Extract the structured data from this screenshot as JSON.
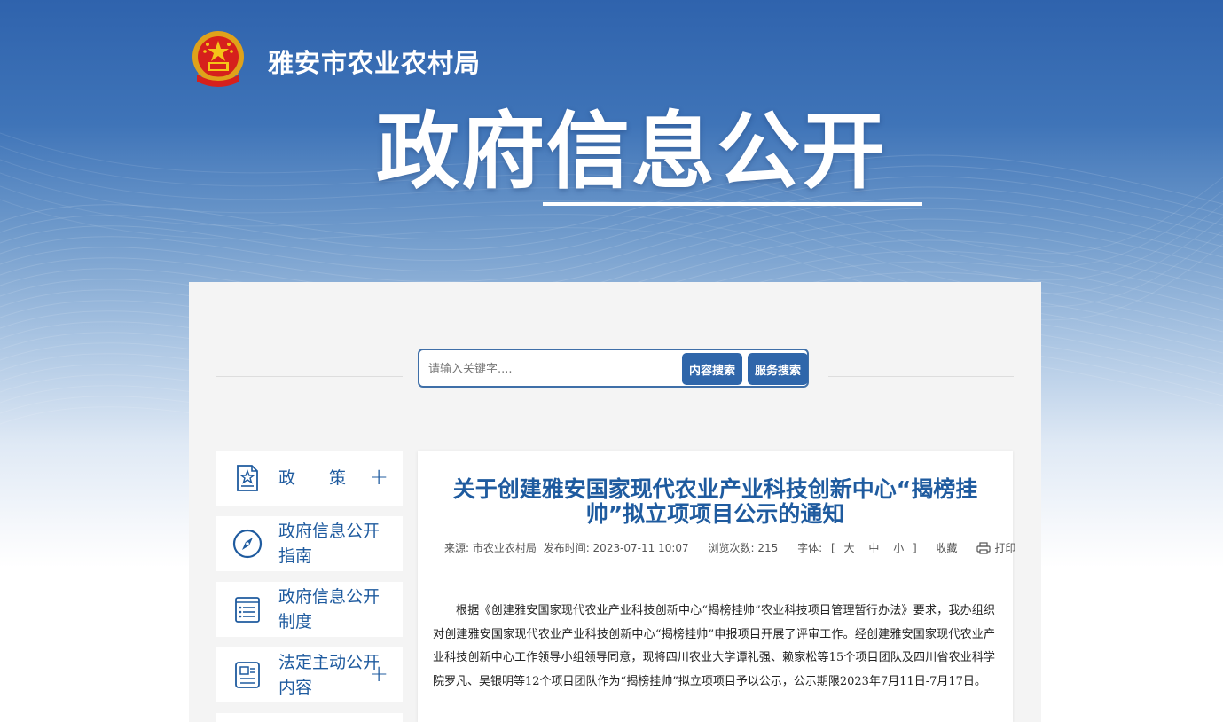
{
  "header": {
    "site_title": "雅安市农业农村局",
    "hero_title": "政府信息公开"
  },
  "search": {
    "placeholder": "请输入关键字....",
    "content_search_label": "内容搜索",
    "service_search_label": "服务搜索"
  },
  "sidebar": {
    "items": [
      {
        "label": "政　　策",
        "icon": "star-document-icon",
        "expandable": true
      },
      {
        "label": "政府信息公开指南",
        "icon": "compass-icon",
        "expandable": false
      },
      {
        "label": "政府信息公开制度",
        "icon": "list-document-icon",
        "expandable": false
      },
      {
        "label": "法定主动公开内容",
        "icon": "id-document-icon",
        "expandable": true
      }
    ],
    "plus_symbol": "+"
  },
  "article": {
    "title": "关于创建雅安国家现代农业产业科技创新中心“揭榜挂帅”拟立项项目公示的通知",
    "meta": {
      "source": "来源: 市农业农村局",
      "publish_time": "发布时间: 2023-07-11 10:07",
      "views": "浏览次数: 215",
      "font_label": "字体:",
      "bracket_open": "[",
      "font_large": "大",
      "font_medium": "中",
      "font_small": "小",
      "bracket_close": "]",
      "favorite": "收藏",
      "print": "打印"
    },
    "body": "根据《创建雅安国家现代农业产业科技创新中心“揭榜挂帅”农业科技项目管理暂行办法》要求，我办组织对创建雅安国家现代农业产业科技创新中心“揭榜挂帅”申报项目开展了评审工作。经创建雅安国家现代农业产业科技创新中心工作领导小组领导同意，现将四川农业大学谭礼强、赖家松等15个项目团队及四川省农业科学院罗凡、吴银明等12个项目团队作为“揭榜挂帅”拟立项项目予以公示，公示期限2023年7月11日-7月17日。"
  },
  "colors": {
    "brand_blue": "#1f5b9f",
    "button_blue": "#2f66aa",
    "banner_top": "#2f63ad"
  }
}
